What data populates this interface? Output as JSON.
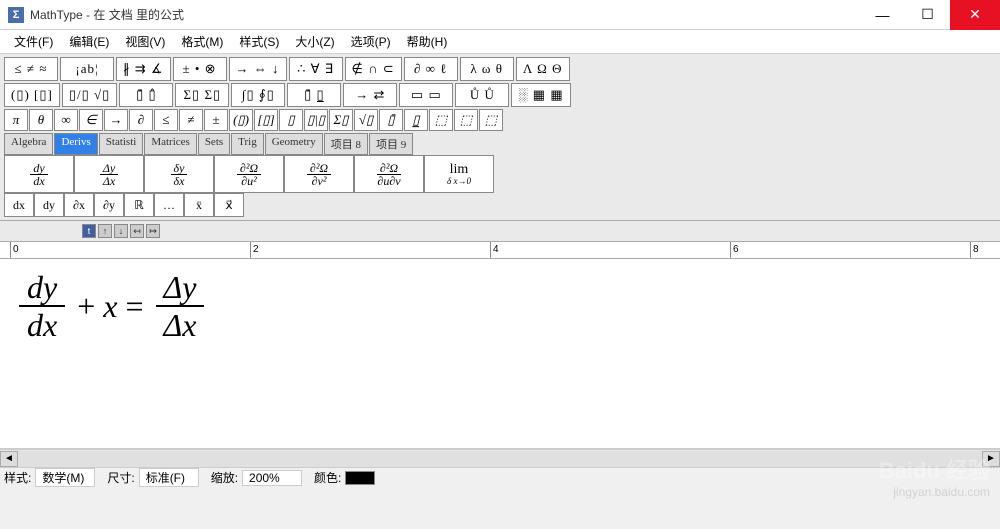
{
  "window": {
    "app": "MathType",
    "title": "MathType - 在 文档 里的公式"
  },
  "window_buttons": {
    "min": "—",
    "max": "☐",
    "close": "✕"
  },
  "menu": [
    {
      "label": "文件(F)"
    },
    {
      "label": "编辑(E)"
    },
    {
      "label": "视图(V)"
    },
    {
      "label": "格式(M)"
    },
    {
      "label": "样式(S)"
    },
    {
      "label": "大小(Z)"
    },
    {
      "label": "选项(P)"
    },
    {
      "label": "帮助(H)"
    }
  ],
  "palettes_row1": [
    "≤ ≠ ≈",
    "¡ab¦",
    "∦ ⇉ ∡",
    "± • ⊗",
    "→ ⇔ ↓",
    "∴ ∀ ∃",
    "∉ ∩ ⊂",
    "∂ ∞ ℓ",
    "λ ω θ",
    "Λ Ω Θ"
  ],
  "palettes_row2": [
    "(▯) [▯]",
    "▯/▯ √▯",
    "▯̄ ▯̂",
    "Σ▯ Σ▯",
    "∫▯ ∮▯",
    "▯̄ ▯̲",
    "→ ⇄",
    "▭ ▭",
    "Ů Ů",
    "░ ▦ ▦"
  ],
  "small_buttons": [
    "π",
    "θ",
    "∞",
    "∈",
    "→",
    "∂",
    "≤",
    "≠",
    "±",
    "(▯)",
    "[▯]",
    "▯",
    "▯|▯",
    "Σ▯",
    "√▯",
    "▯̄",
    "▯̲",
    "⬚",
    "⬚",
    "⬚"
  ],
  "tabs": [
    {
      "label": "Algebra",
      "active": false
    },
    {
      "label": "Derivs",
      "active": true
    },
    {
      "label": "Statisti",
      "active": false
    },
    {
      "label": "Matrices",
      "active": false
    },
    {
      "label": "Sets",
      "active": false
    },
    {
      "label": "Trig",
      "active": false
    },
    {
      "label": "Geometry",
      "active": false
    },
    {
      "label": "项目 8",
      "active": false
    },
    {
      "label": "项目 9",
      "active": false
    }
  ],
  "deriv_templates": [
    {
      "num": "dy",
      "den": "dx"
    },
    {
      "num": "Δy",
      "den": "Δx"
    },
    {
      "num": "δy",
      "den": "δx"
    },
    {
      "num": "∂²Ω",
      "den": "∂u²"
    },
    {
      "num": "∂²Ω",
      "den": "∂v²"
    },
    {
      "num": "∂²Ω",
      "den": "∂u∂v"
    }
  ],
  "lim_template": {
    "top": "lim",
    "bottom": "δ x→0"
  },
  "deriv_row2": [
    "dx",
    "dy",
    "∂x",
    "∂y",
    "ℝ",
    "…",
    "ẍ",
    "x⃗"
  ],
  "nav": [
    "t",
    "↑",
    "↓",
    "↤",
    "↦"
  ],
  "ruler": {
    "marks": [
      0,
      2,
      4,
      6,
      8
    ]
  },
  "equation": {
    "frac1": {
      "num": "dy",
      "den": "dx"
    },
    "plus": "+",
    "var": "x",
    "eq": "=",
    "frac2": {
      "num": "Δy",
      "den": "Δx"
    }
  },
  "status": {
    "style_label": "样式:",
    "style_value": "数学(M)",
    "size_label": "尺寸:",
    "size_value": "标准(F)",
    "zoom_label": "缩放:",
    "zoom_value": "200%",
    "color_label": "颜色:"
  },
  "watermark": {
    "brand": "Baidu 经验",
    "url": "jingyan.baidu.com"
  }
}
